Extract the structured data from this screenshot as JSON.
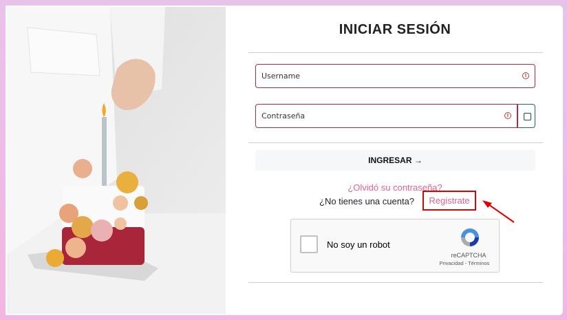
{
  "login": {
    "title": "INICIAR SESIÓN",
    "username_placeholder": "Username",
    "password_placeholder": "Contraseña",
    "submit_label": "INGRESAR",
    "submit_arrow": "→",
    "forgot_link": "¿Olvidó su contraseña?",
    "no_account_text": "¿No tienes una cuenta?",
    "register_link": "Registrate"
  },
  "captcha": {
    "label": "No soy un robot",
    "brand": "reCAPTCHA",
    "terms": "Privacidad - Términos"
  },
  "colors": {
    "field_error_border": "#b02a3f",
    "link": "#e0628f",
    "highlight": "#e00000",
    "background": "#f3b6e3"
  },
  "icons": {
    "field_warning": "exclamation-circle-icon",
    "password_toggle": "checkbox-icon",
    "submit_arrow": "arrow-right-icon",
    "annotation": "red-arrow-icon"
  }
}
